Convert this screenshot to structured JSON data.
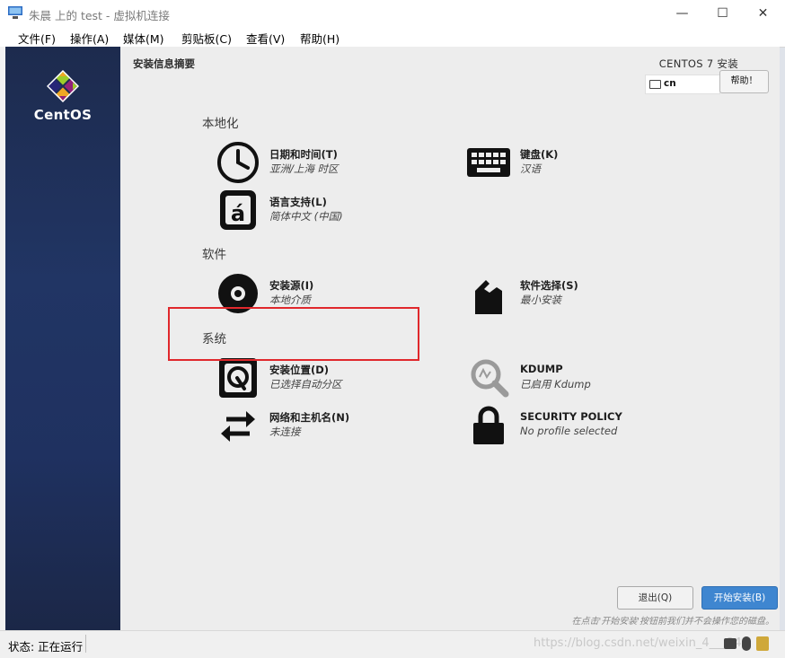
{
  "window": {
    "title": "朱晨 上的 test - 虚拟机连接",
    "minimize": "—",
    "maximize": "☐",
    "close": "✕"
  },
  "menu": [
    "文件(F)",
    "操作(A)",
    "媒体(M)",
    "剪贴板(C)",
    "查看(V)",
    "帮助(H)"
  ],
  "installer": {
    "brand": "CentOS",
    "header_left": "安装信息摘要",
    "header_right": "CENTOS 7 安装",
    "keyboard_layout": "cn",
    "help_button": "帮助！",
    "sections": {
      "localization": "本地化",
      "software": "软件",
      "system": "系统"
    },
    "spokes": {
      "datetime": {
        "title": "日期和时间(T)",
        "status": "亚洲/上海 时区",
        "icon": "clock-icon"
      },
      "keyboard": {
        "title": "键盘(K)",
        "status": "汉语",
        "icon": "keyboard-icon"
      },
      "language": {
        "title": "语言支持(L)",
        "status": "简体中文 (中国)",
        "icon": "language-icon"
      },
      "source": {
        "title": "安装源(I)",
        "status": "本地介质",
        "icon": "disc-icon"
      },
      "software": {
        "title": "软件选择(S)",
        "status": "最小安装",
        "icon": "package-icon"
      },
      "destination": {
        "title": "安装位置(D)",
        "status": "已选择自动分区",
        "icon": "harddisk-icon"
      },
      "kdump": {
        "title": "KDUMP",
        "status": "已启用 Kdump",
        "icon": "kdump-search-icon"
      },
      "network": {
        "title": "网络和主机名(N)",
        "status": "未连接",
        "icon": "network-arrows-icon"
      },
      "security": {
        "title": "SECURITY POLICY",
        "status": "No profile selected",
        "icon": "lock-icon"
      }
    },
    "quit_button": "退出(Q)",
    "start_button": "开始安装(B)",
    "hint": "在点击'开始安装'按钮前我们并不会操作您的磁盘。"
  },
  "statusbar": {
    "status": "状态: 正在运行",
    "watermark": "https://blog.csdn.net/weixin_4___24"
  },
  "colors": {
    "sidebar": "#213564",
    "start_button": "#3f86d0",
    "highlight_box": "#e0282c"
  }
}
